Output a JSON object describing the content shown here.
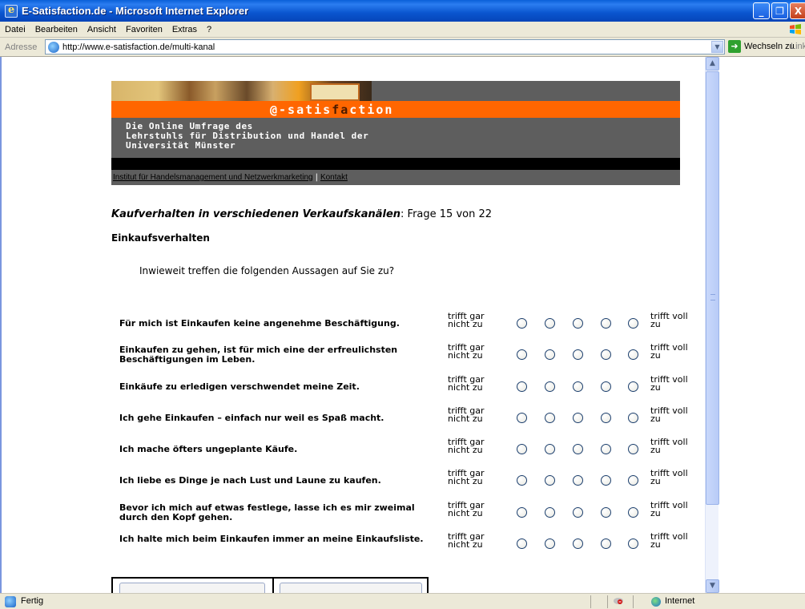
{
  "window": {
    "title": "E-Satisfaction.de - Microsoft Internet Explorer",
    "btn_min": "_",
    "btn_max": "❐",
    "btn_close": "X"
  },
  "menu": [
    "Datei",
    "Bearbeiten",
    "Ansicht",
    "Favoriten",
    "Extras",
    "?"
  ],
  "address": {
    "label": "Adresse",
    "url": "http://www.e-satisfaction.de/multi-kanal",
    "go_label": "Wechseln zu",
    "links_label": "Link"
  },
  "banner": {
    "logo_prefix": "@-satis",
    "logo_highlight": "fa",
    "logo_suffix": "ction",
    "subtitle": [
      "Die Online Umfrage des",
      "Lehrstuhls für Distribution und Handel der",
      "Universität Münster"
    ],
    "link1": "Institut für Handelsmanagement und Netzwerkmarketing",
    "link_sep": "|",
    "link2": "Kontakt"
  },
  "question": {
    "section": "Kaufverhalten in verschiedenen Verkaufskanälen",
    "counter": ": Frage 15 von 22",
    "topic": "Einkaufsverhalten",
    "prompt": "Inwieweit treffen die folgenden Aussagen auf Sie zu?"
  },
  "scale": {
    "left_label": "trifft gar nicht zu",
    "right_label": "trifft voll zu"
  },
  "statements": [
    "Für mich ist Einkaufen keine angenehme Beschäftigung.",
    "Einkaufen zu gehen, ist für mich eine der erfreulichsten Beschäftigungen im Leben.",
    "Einkäufe zu erledigen verschwendet meine Zeit.",
    "Ich gehe Einkaufen – einfach nur weil es Spaß macht.",
    "Ich mache öfters ungeplante Käufe.",
    "Ich liebe es Dinge je nach Lust und Laune zu kaufen.",
    "Bevor ich mich auf etwas festlege, lasse ich es mir zweimal durch den Kopf gehen.",
    "Ich halte mich beim Einkaufen immer an meine Einkaufsliste."
  ],
  "status": {
    "text": "Fertig",
    "zone": "Internet"
  },
  "icons": {
    "app": "ie-icon",
    "page": "ie-page-icon",
    "go": "green-arrow-icon",
    "xp": "windows-flag-icon",
    "status": "page-done-icon",
    "lock": "security-icon",
    "zone": "internet-globe-icon"
  },
  "colors": {
    "titlebar": "#0a55cf",
    "banner_orange": "#ff6600",
    "banner_gray": "#5e5e5e",
    "chrome": "#ece9d8"
  }
}
